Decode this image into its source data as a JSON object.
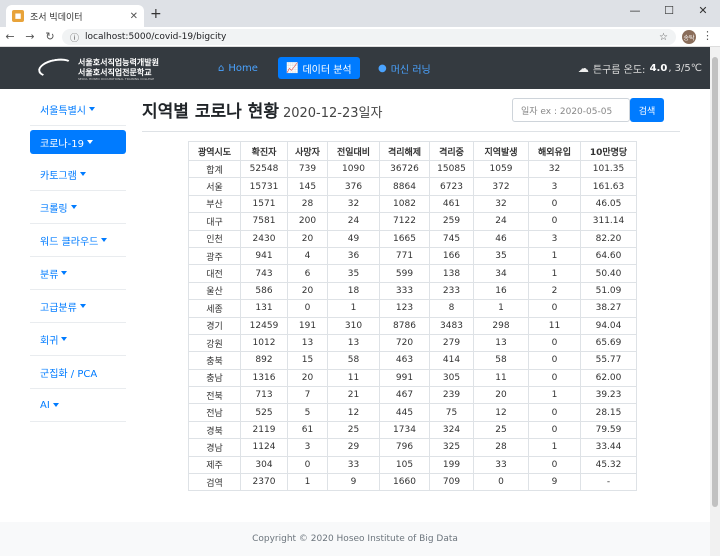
{
  "browser": {
    "tab_title": "조서 빅데이터",
    "url": "localhost:5000/covid-19/bigcity",
    "avatar_text": "송탁"
  },
  "navbar": {
    "logo_line1": "서울호서직업능력개발원",
    "logo_line2": "서울호서직업전문학교",
    "logo_line3": "SEOUL HOSEO OCCUPATIONAL TRAINING COLLEGE",
    "items": [
      {
        "label": "Home"
      },
      {
        "label": "데이터 분석"
      },
      {
        "label": "머신 러닝"
      }
    ],
    "weather_prefix": "튼구름 온도:",
    "weather_temp": "4.0",
    "weather_range": ", 3/5℃"
  },
  "sidebar": {
    "items": [
      {
        "label": "서울특별시"
      },
      {
        "label": "코로나-19"
      },
      {
        "label": "카토그램"
      },
      {
        "label": "크롤링"
      },
      {
        "label": "워드 클라우드"
      },
      {
        "label": "분류"
      },
      {
        "label": "고급분류"
      },
      {
        "label": "회귀"
      },
      {
        "label": "군집화 / PCA"
      },
      {
        "label": "AI"
      }
    ]
  },
  "main": {
    "title": "지역별 코로나 현황",
    "date": "2020-12-23일자",
    "date_placeholder": "일자 ex : 2020-05-05",
    "search_label": "검색"
  },
  "table": {
    "headers": [
      "광역시도",
      "확진자",
      "사망자",
      "전일대비",
      "격리해제",
      "격리중",
      "지역발생",
      "해외유입",
      "10만명당"
    ],
    "rows": [
      [
        "합계",
        "52548",
        "739",
        "1090",
        "36726",
        "15085",
        "1059",
        "32",
        "101.35"
      ],
      [
        "서울",
        "15731",
        "145",
        "376",
        "8864",
        "6723",
        "372",
        "3",
        "161.63"
      ],
      [
        "부산",
        "1571",
        "28",
        "32",
        "1082",
        "461",
        "32",
        "0",
        "46.05"
      ],
      [
        "대구",
        "7581",
        "200",
        "24",
        "7122",
        "259",
        "24",
        "0",
        "311.14"
      ],
      [
        "인천",
        "2430",
        "20",
        "49",
        "1665",
        "745",
        "46",
        "3",
        "82.20"
      ],
      [
        "광주",
        "941",
        "4",
        "36",
        "771",
        "166",
        "35",
        "1",
        "64.60"
      ],
      [
        "대전",
        "743",
        "6",
        "35",
        "599",
        "138",
        "34",
        "1",
        "50.40"
      ],
      [
        "울산",
        "586",
        "20",
        "18",
        "333",
        "233",
        "16",
        "2",
        "51.09"
      ],
      [
        "세종",
        "131",
        "0",
        "1",
        "123",
        "8",
        "1",
        "0",
        "38.27"
      ],
      [
        "경기",
        "12459",
        "191",
        "310",
        "8786",
        "3483",
        "298",
        "11",
        "94.04"
      ],
      [
        "강원",
        "1012",
        "13",
        "13",
        "720",
        "279",
        "13",
        "0",
        "65.69"
      ],
      [
        "충북",
        "892",
        "15",
        "58",
        "463",
        "414",
        "58",
        "0",
        "55.77"
      ],
      [
        "충남",
        "1316",
        "20",
        "11",
        "991",
        "305",
        "11",
        "0",
        "62.00"
      ],
      [
        "전북",
        "713",
        "7",
        "21",
        "467",
        "239",
        "20",
        "1",
        "39.23"
      ],
      [
        "전남",
        "525",
        "5",
        "12",
        "445",
        "75",
        "12",
        "0",
        "28.15"
      ],
      [
        "경북",
        "2119",
        "61",
        "25",
        "1734",
        "324",
        "25",
        "0",
        "79.59"
      ],
      [
        "경남",
        "1124",
        "3",
        "29",
        "796",
        "325",
        "28",
        "1",
        "33.44"
      ],
      [
        "제주",
        "304",
        "0",
        "33",
        "105",
        "199",
        "33",
        "0",
        "45.32"
      ],
      [
        "검역",
        "2370",
        "1",
        "9",
        "1660",
        "709",
        "0",
        "9",
        "-"
      ]
    ]
  },
  "footer": {
    "text": "Copyright © 2020 Hoseo Institute of Big Data"
  }
}
